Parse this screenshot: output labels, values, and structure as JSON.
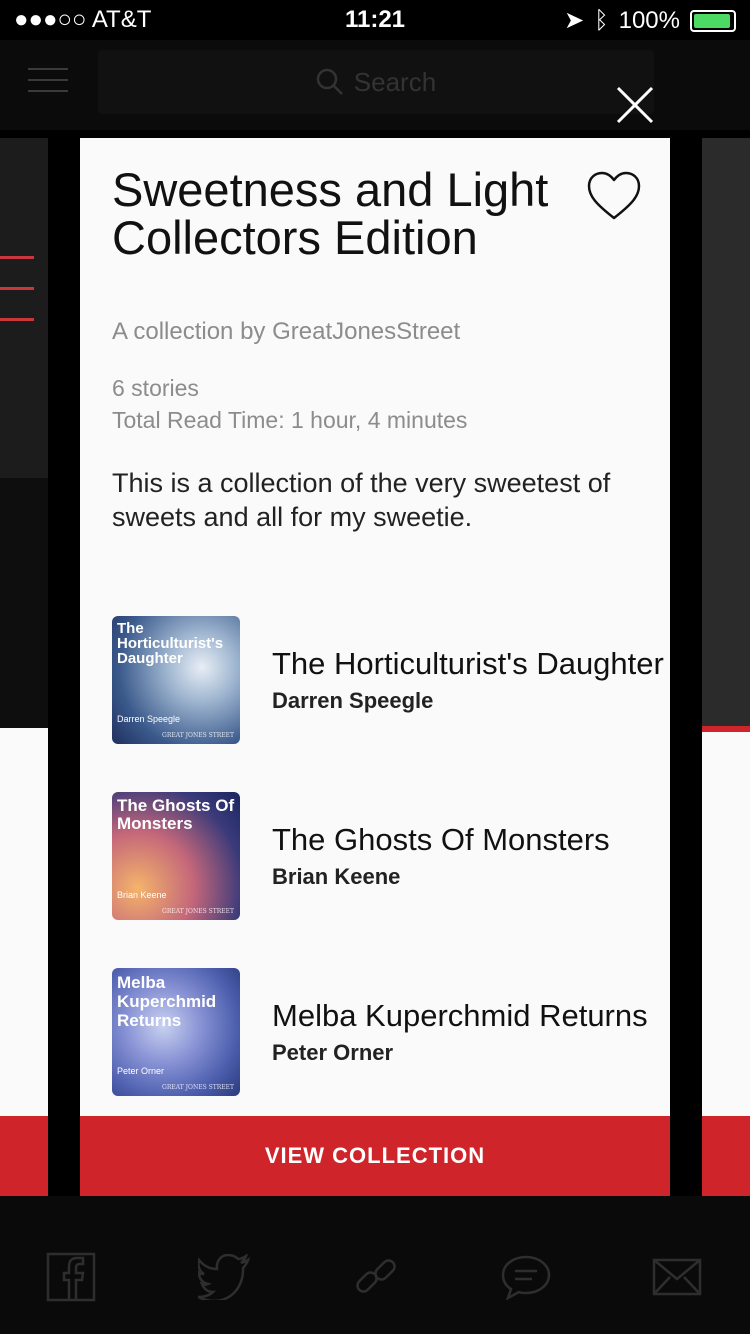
{
  "status_bar": {
    "carrier": "●●●○○ AT&T",
    "time": "11:21",
    "battery": "100%"
  },
  "header": {
    "search_placeholder": "Search"
  },
  "collection": {
    "title": "Sweetness and Light Collectors Edition",
    "byline": "A collection by GreatJonesStreet",
    "stories_count": "6 stories",
    "read_time": "Total Read Time: 1 hour, 4 minutes",
    "description": "This is a collection of the very sweetest of sweets and all for my sweetie.",
    "view_button": "VIEW COLLECTION"
  },
  "stories": [
    {
      "title": "The Horticulturist's Daughter",
      "author": "Darren Speegle",
      "cover_title": "The Horticulturist's Daughter",
      "cover_author": "Darren Speegle"
    },
    {
      "title": "The Ghosts Of Monsters",
      "author": "Brian Keene",
      "cover_title": "The Ghosts Of Monsters",
      "cover_author": "Brian Keene"
    },
    {
      "title": "Melba Kuperchmid Returns",
      "author": "Peter Orner",
      "cover_title": "Melba Kuperchmid Returns",
      "cover_author": "Peter Orner"
    }
  ],
  "cover_publisher": "GREAT JONES STREET",
  "colors": {
    "accent_red": "#d0242b",
    "background": "#000000",
    "card": "#fafafa"
  },
  "icons": [
    "search-icon",
    "close-icon",
    "heart-icon",
    "facebook-icon",
    "twitter-icon",
    "link-icon",
    "comment-icon",
    "mail-icon",
    "hamburger-icon"
  ]
}
